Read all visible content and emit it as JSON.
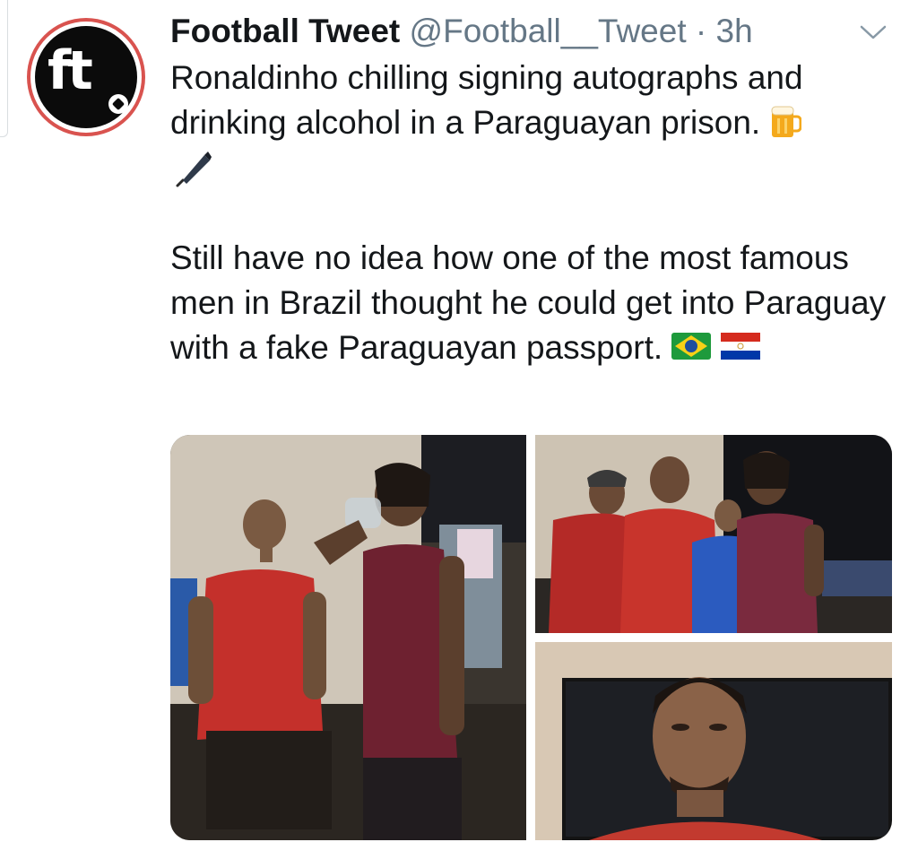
{
  "tweet": {
    "author_name": "Football Tweet",
    "author_handle": "@Football__Tweet",
    "separator": " · ",
    "time": "3h",
    "avatar_text": "ft",
    "text_line1": "Ronaldinho chilling signing autographs and drinking alcohol in a Paraguayan prison.",
    "text_line2": "Still have no idea how one of the most famous men in Brazil thought he could get into Paraguay with a fake Paraguayan passport.",
    "emoji_icons": [
      "beer-mug-icon",
      "fountain-pen-icon",
      "brazil-flag-icon",
      "paraguay-flag-icon"
    ]
  },
  "media": {
    "count": 3,
    "photos": [
      "photo-drinking",
      "photo-signing-autographs",
      "photo-inmate-portrait"
    ]
  },
  "colors": {
    "text": "#14171a",
    "secondary": "#657786",
    "avatar_ring": "#d9534f",
    "avatar_bg": "#0b0b0b"
  }
}
